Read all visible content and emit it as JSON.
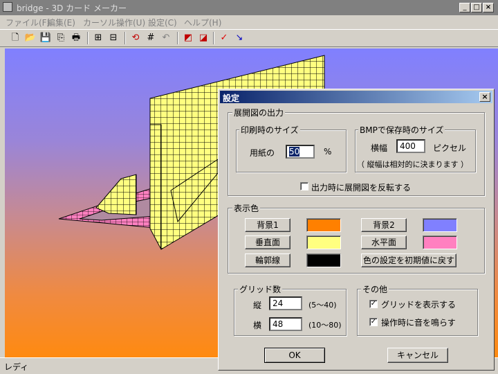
{
  "window": {
    "title": "bridge - 3D カード メーカー"
  },
  "menu": [
    "ファイル(F)",
    "編集(E)",
    "カーソル操作(U)",
    "設定(C)",
    "ヘルプ(H)"
  ],
  "status": {
    "text": "レディ"
  },
  "dialog": {
    "title": "設定",
    "unfold_group": "展開図の出力",
    "print_group": "印刷時のサイズ",
    "paper_label": "用紙の",
    "paper_value": "50",
    "paper_unit": "%",
    "bmp_group": "BMPで保存時のサイズ",
    "width_label": "横幅",
    "width_value": "400",
    "width_unit": "ピクセル",
    "bmp_note": "（ 縦幅は相対的に決まります ）",
    "invert_label": "出力時に展開図を反転する",
    "invert_checked": false,
    "color_group": "表示色",
    "colors": {
      "bg1": {
        "label": "背景1",
        "color": "#ff8000"
      },
      "bg2": {
        "label": "背景2",
        "color": "#8080ff"
      },
      "vertical": {
        "label": "垂直面",
        "color": "#ffff80"
      },
      "horizontal": {
        "label": "水平面",
        "color": "#ff80c0"
      },
      "outline": {
        "label": "輪郭線",
        "color": "#000000"
      }
    },
    "reset_colors": "色の設定を初期値に戻す",
    "grid_group": "グリッド数",
    "vertical_label": "縦",
    "vertical_value": "24",
    "vertical_range": "(5〜40)",
    "horizontal_label": "横",
    "horizontal_value": "48",
    "horizontal_range": "(10〜80)",
    "other_group": "その他",
    "show_grid_label": "グリッドを表示する",
    "show_grid_checked": true,
    "sound_label": "操作時に音を鳴らす",
    "sound_checked": true,
    "ok": "OK",
    "cancel": "キャンセル"
  }
}
